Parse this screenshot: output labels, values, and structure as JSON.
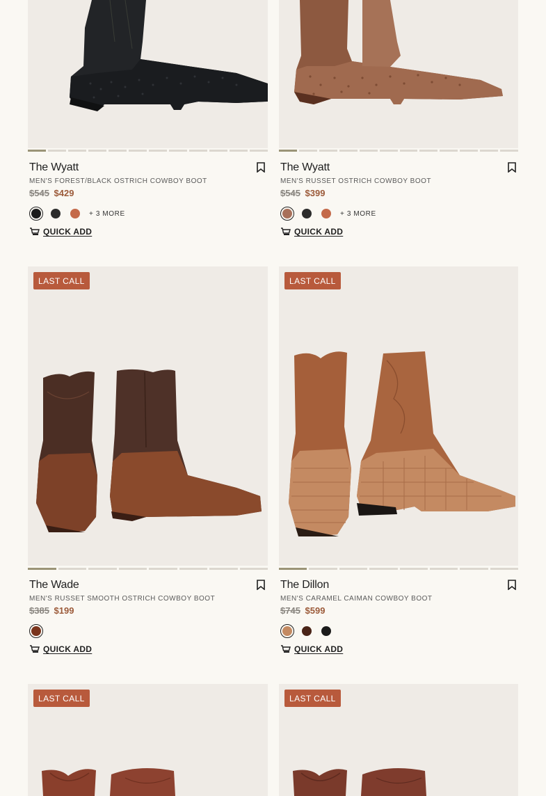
{
  "products": [
    {
      "badge": "",
      "name": "The Wyatt",
      "desc": "Men's Forest/Black Ostrich Cowboy Boot",
      "price_old": "$545",
      "price_new": "$429",
      "swatches": [
        "#1b1b1b",
        "#2c2c2c",
        "#c46a4a"
      ],
      "more": "+ 3 MORE",
      "quick_add": "QUICK ADD",
      "slides": 12
    },
    {
      "badge": "",
      "name": "The Wyatt",
      "desc": "Men's Russet Ostrich Cowboy Boot",
      "price_old": "$545",
      "price_new": "$399",
      "swatches": [
        "#a8705a",
        "#2c2c2c",
        "#c46a4a"
      ],
      "more": "+ 3 MORE",
      "quick_add": "QUICK ADD",
      "slides": 12
    },
    {
      "badge": "LAST CALL",
      "name": "The Wade",
      "desc": "Men's Russet Smooth Ostrich Cowboy Boot",
      "price_old": "$385",
      "price_new": "$199",
      "swatches": [
        "#7a341c"
      ],
      "more": "",
      "quick_add": "QUICK ADD",
      "slides": 8
    },
    {
      "badge": "LAST CALL",
      "name": "The Dillon",
      "desc": "Men's Caramel Caiman Cowboy Boot",
      "price_old": "$745",
      "price_new": "$599",
      "swatches": [
        "#c48a62",
        "#4a2418",
        "#1b1b1b"
      ],
      "more": "",
      "quick_add": "QUICK ADD",
      "slides": 8
    },
    {
      "badge": "LAST CALL"
    },
    {
      "badge": "LAST CALL"
    }
  ],
  "icons": {
    "bookmark": "bookmark-icon",
    "quick_add": "cart-icon"
  }
}
